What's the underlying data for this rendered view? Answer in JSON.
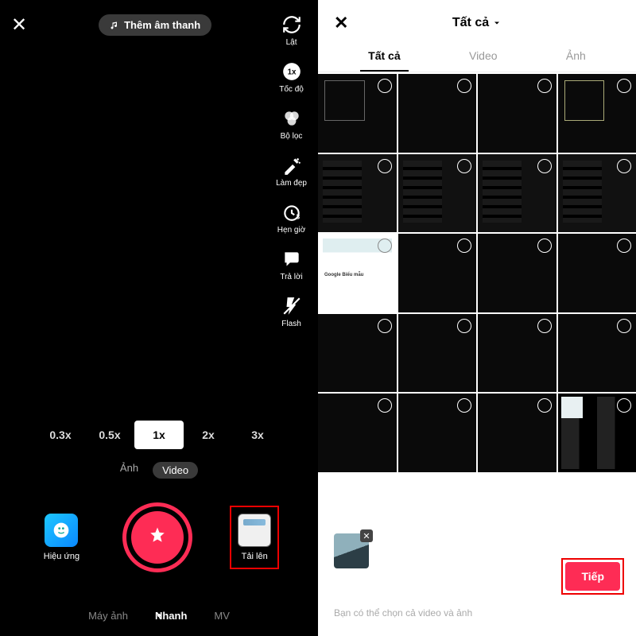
{
  "left": {
    "add_sound": "Thêm âm thanh",
    "tools": {
      "flip": "Lật",
      "speed": "Tốc độ",
      "filters": "Bộ lọc",
      "beauty": "Làm đẹp",
      "timer": "Hẹn giờ",
      "reply": "Trả lời",
      "flash": "Flash"
    },
    "speeds": [
      "0.3x",
      "0.5x",
      "1x",
      "2x",
      "3x"
    ],
    "speed_selected": "1x",
    "media_toggle": {
      "photo": "Ảnh",
      "video": "Video",
      "selected": "Video"
    },
    "effects": "Hiệu ứng",
    "upload": "Tải lên",
    "modes": {
      "camera": "Máy ảnh",
      "quick": "Nhanh",
      "mv": "MV",
      "selected": "Nhanh"
    }
  },
  "right": {
    "title": "Tất cả",
    "tabs": {
      "all": "Tất cả",
      "video": "Video",
      "photo": "Ảnh",
      "selected": "Tất cả"
    },
    "hint": "Bạn có thể chọn cả video và ảnh",
    "next": "Tiếp"
  }
}
